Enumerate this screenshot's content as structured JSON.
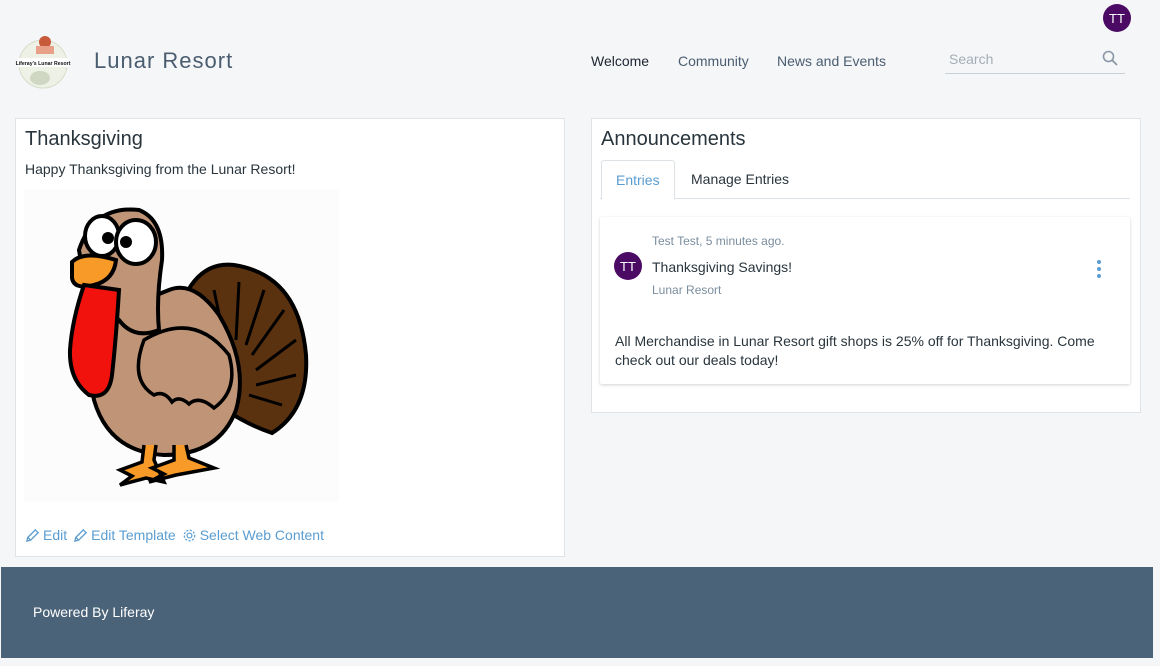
{
  "header": {
    "avatar_initials": "TT",
    "logo_text": "Liferay's Lunar Resort",
    "site_title": "Lunar Resort",
    "nav": {
      "welcome": "Welcome",
      "community": "Community",
      "news": "News and Events"
    },
    "search_placeholder": "Search"
  },
  "web_content": {
    "title": "Thanksgiving",
    "text": "Happy Thanksgiving from the Lunar Resort!",
    "actions": {
      "edit": "Edit",
      "edit_template": "Edit Template",
      "select": "Select Web Content"
    }
  },
  "announcements": {
    "title": "Announcements",
    "tabs": {
      "entries": "Entries",
      "manage": "Manage Entries"
    },
    "entry": {
      "avatar_initials": "TT",
      "meta": "Test Test, 5 minutes ago.",
      "title": "Thanksgiving Savings!",
      "site": "Lunar Resort",
      "body": "All Merchandise in Lunar Resort gift shops is 25% off for Thanksgiving. Come check out our deals today!"
    }
  },
  "footer": {
    "text": "Powered By Liferay"
  },
  "colors": {
    "accent": "#5a9dd1",
    "avatar": "#4b0a63",
    "footer": "#4b6378"
  }
}
